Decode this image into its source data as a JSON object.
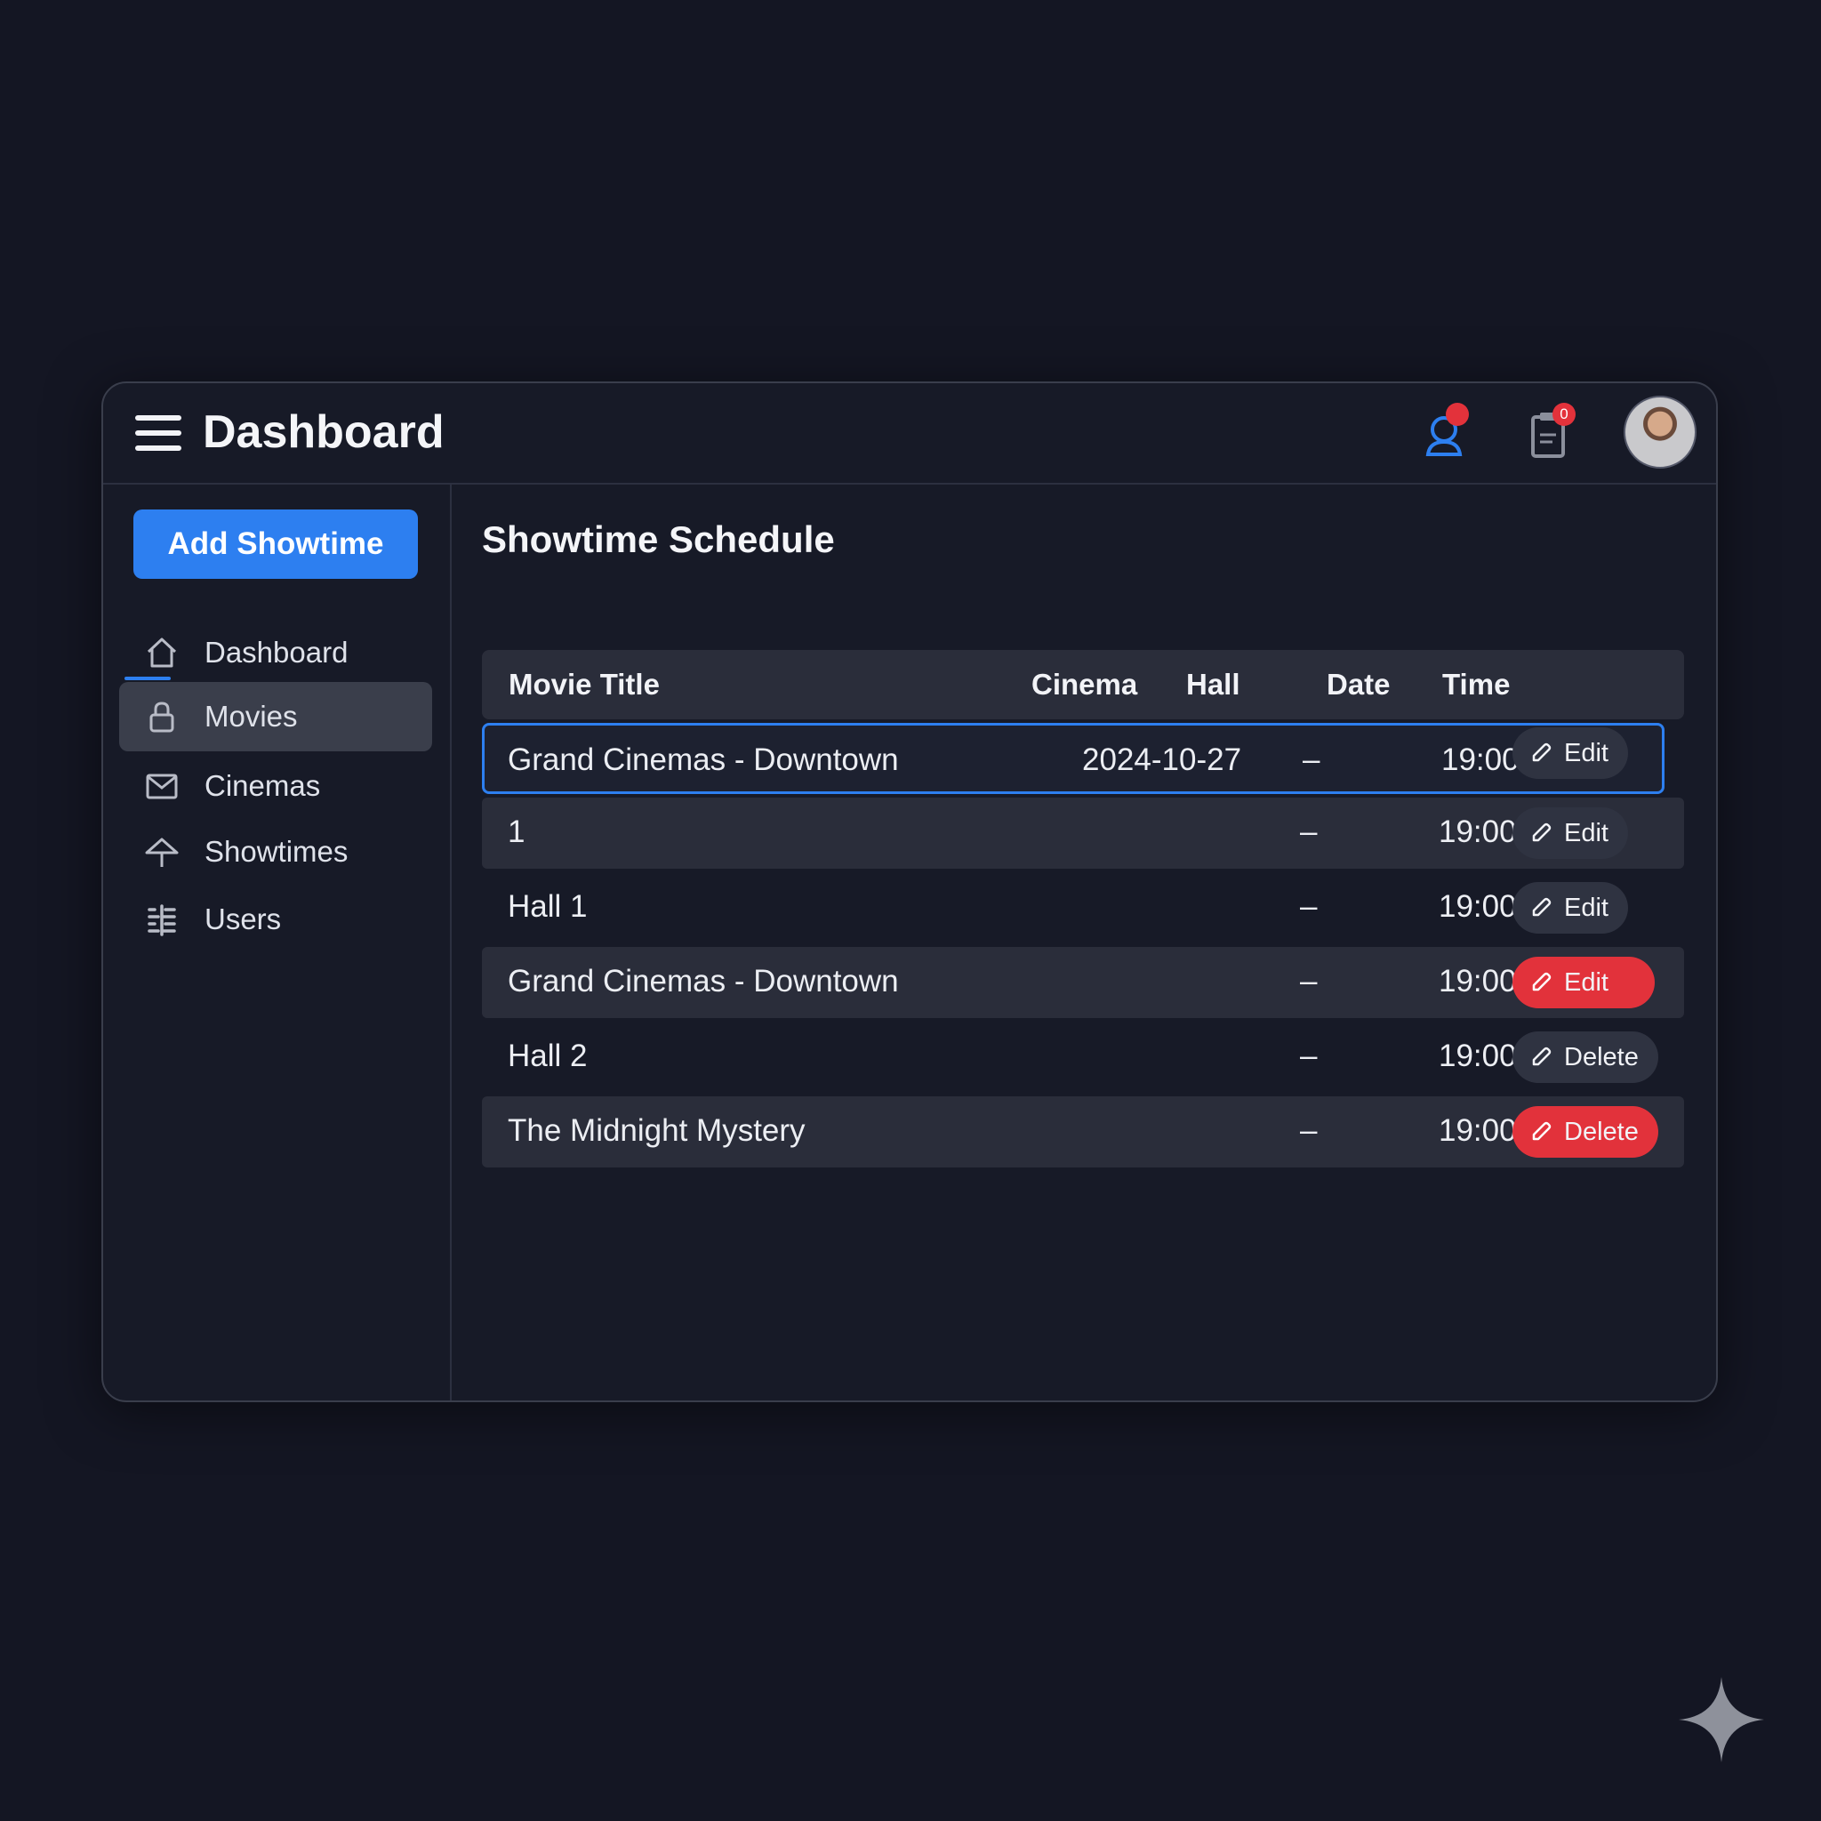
{
  "app": {
    "title": "Dashboard"
  },
  "sidebar": {
    "add_button": "Add Showtime",
    "items": [
      {
        "label": "Dashboard",
        "icon": "home-icon"
      },
      {
        "label": "Movies",
        "icon": "lock-icon"
      },
      {
        "label": "Cinemas",
        "icon": "mail-icon"
      },
      {
        "label": "Showtimes",
        "icon": "umbrella-icon"
      },
      {
        "label": "Users",
        "icon": "grid-icon"
      }
    ],
    "active_index": 1
  },
  "main": {
    "title": "Showtime Schedule",
    "table": {
      "headers": [
        "Movie Title",
        "Cinema",
        "Hall",
        "Date",
        "Time"
      ],
      "rows": [
        {
          "title": "Grand Cinemas - Downtown",
          "date": "2024-10-27",
          "dash": "–",
          "time": "19:00",
          "action": "Edit"
        },
        {
          "title": "1",
          "dash": "–",
          "time": "19:00",
          "action": "Edit"
        },
        {
          "title": "Hall 1",
          "dash": "–",
          "time": "19:00",
          "action": "Edit"
        },
        {
          "title": "Grand Cinemas - Downtown",
          "dash": "–",
          "time": "19:00",
          "action": "Edit"
        },
        {
          "title": "Hall 2",
          "dash": "–",
          "time": "19:00",
          "action": "Delete"
        },
        {
          "title": "The Midnight Mystery",
          "dash": "–",
          "time": "19:00",
          "action": "Delete"
        }
      ]
    }
  },
  "topbar": {
    "clipboard_badge": "0"
  },
  "colors": {
    "accent": "#2d7ff0",
    "danger": "#e2323b",
    "background": "#141623"
  }
}
